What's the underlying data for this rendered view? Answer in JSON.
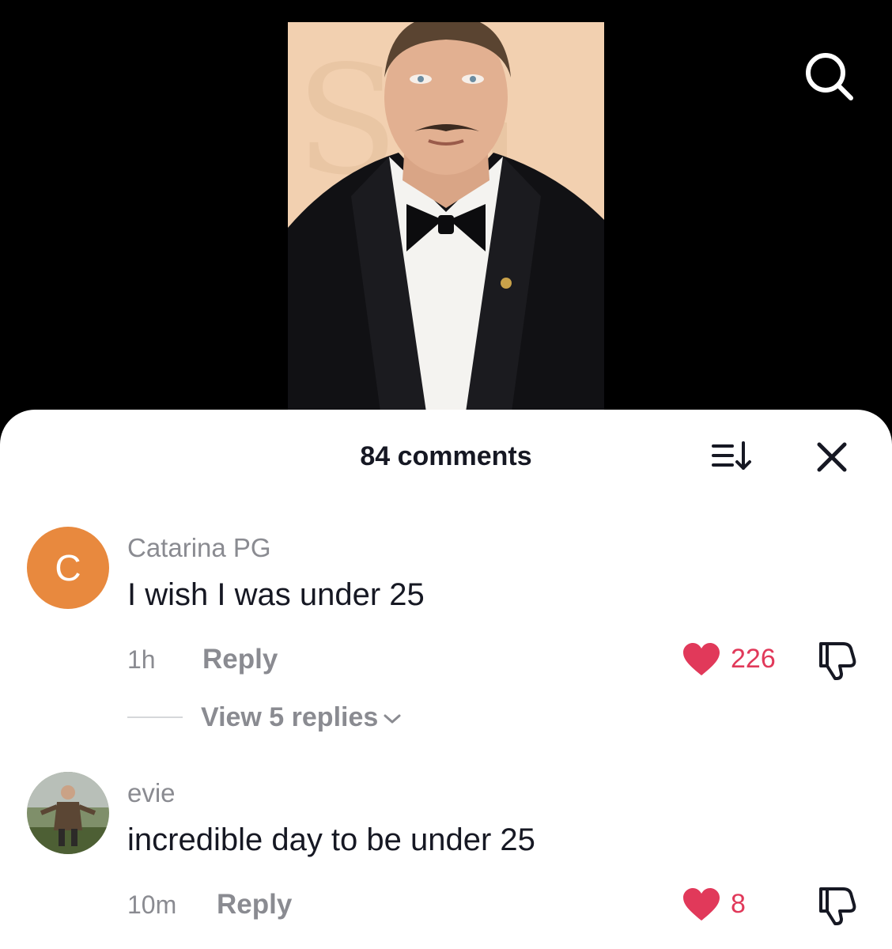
{
  "video": {
    "image_description": "photo-of-man-in-tuxedo"
  },
  "header": {
    "search_icon": "search-icon"
  },
  "sheet": {
    "title": "84 comments",
    "sort_icon": "sort-icon",
    "close_icon": "close-icon"
  },
  "comments": [
    {
      "avatar_letter": "C",
      "avatar_color": "#e8893e",
      "username": "Catarina PG",
      "text": "I wish I was under 25",
      "time": "1h",
      "reply_label": "Reply",
      "likes": "226",
      "liked": true,
      "view_replies": "View 5 replies"
    },
    {
      "username": "evie",
      "text": "incredible day to be under 25",
      "time": "10m",
      "reply_label": "Reply",
      "likes": "8",
      "liked": true
    }
  ],
  "colors": {
    "like": "#e1395a",
    "muted": "#8a8b91",
    "text": "#161823"
  }
}
